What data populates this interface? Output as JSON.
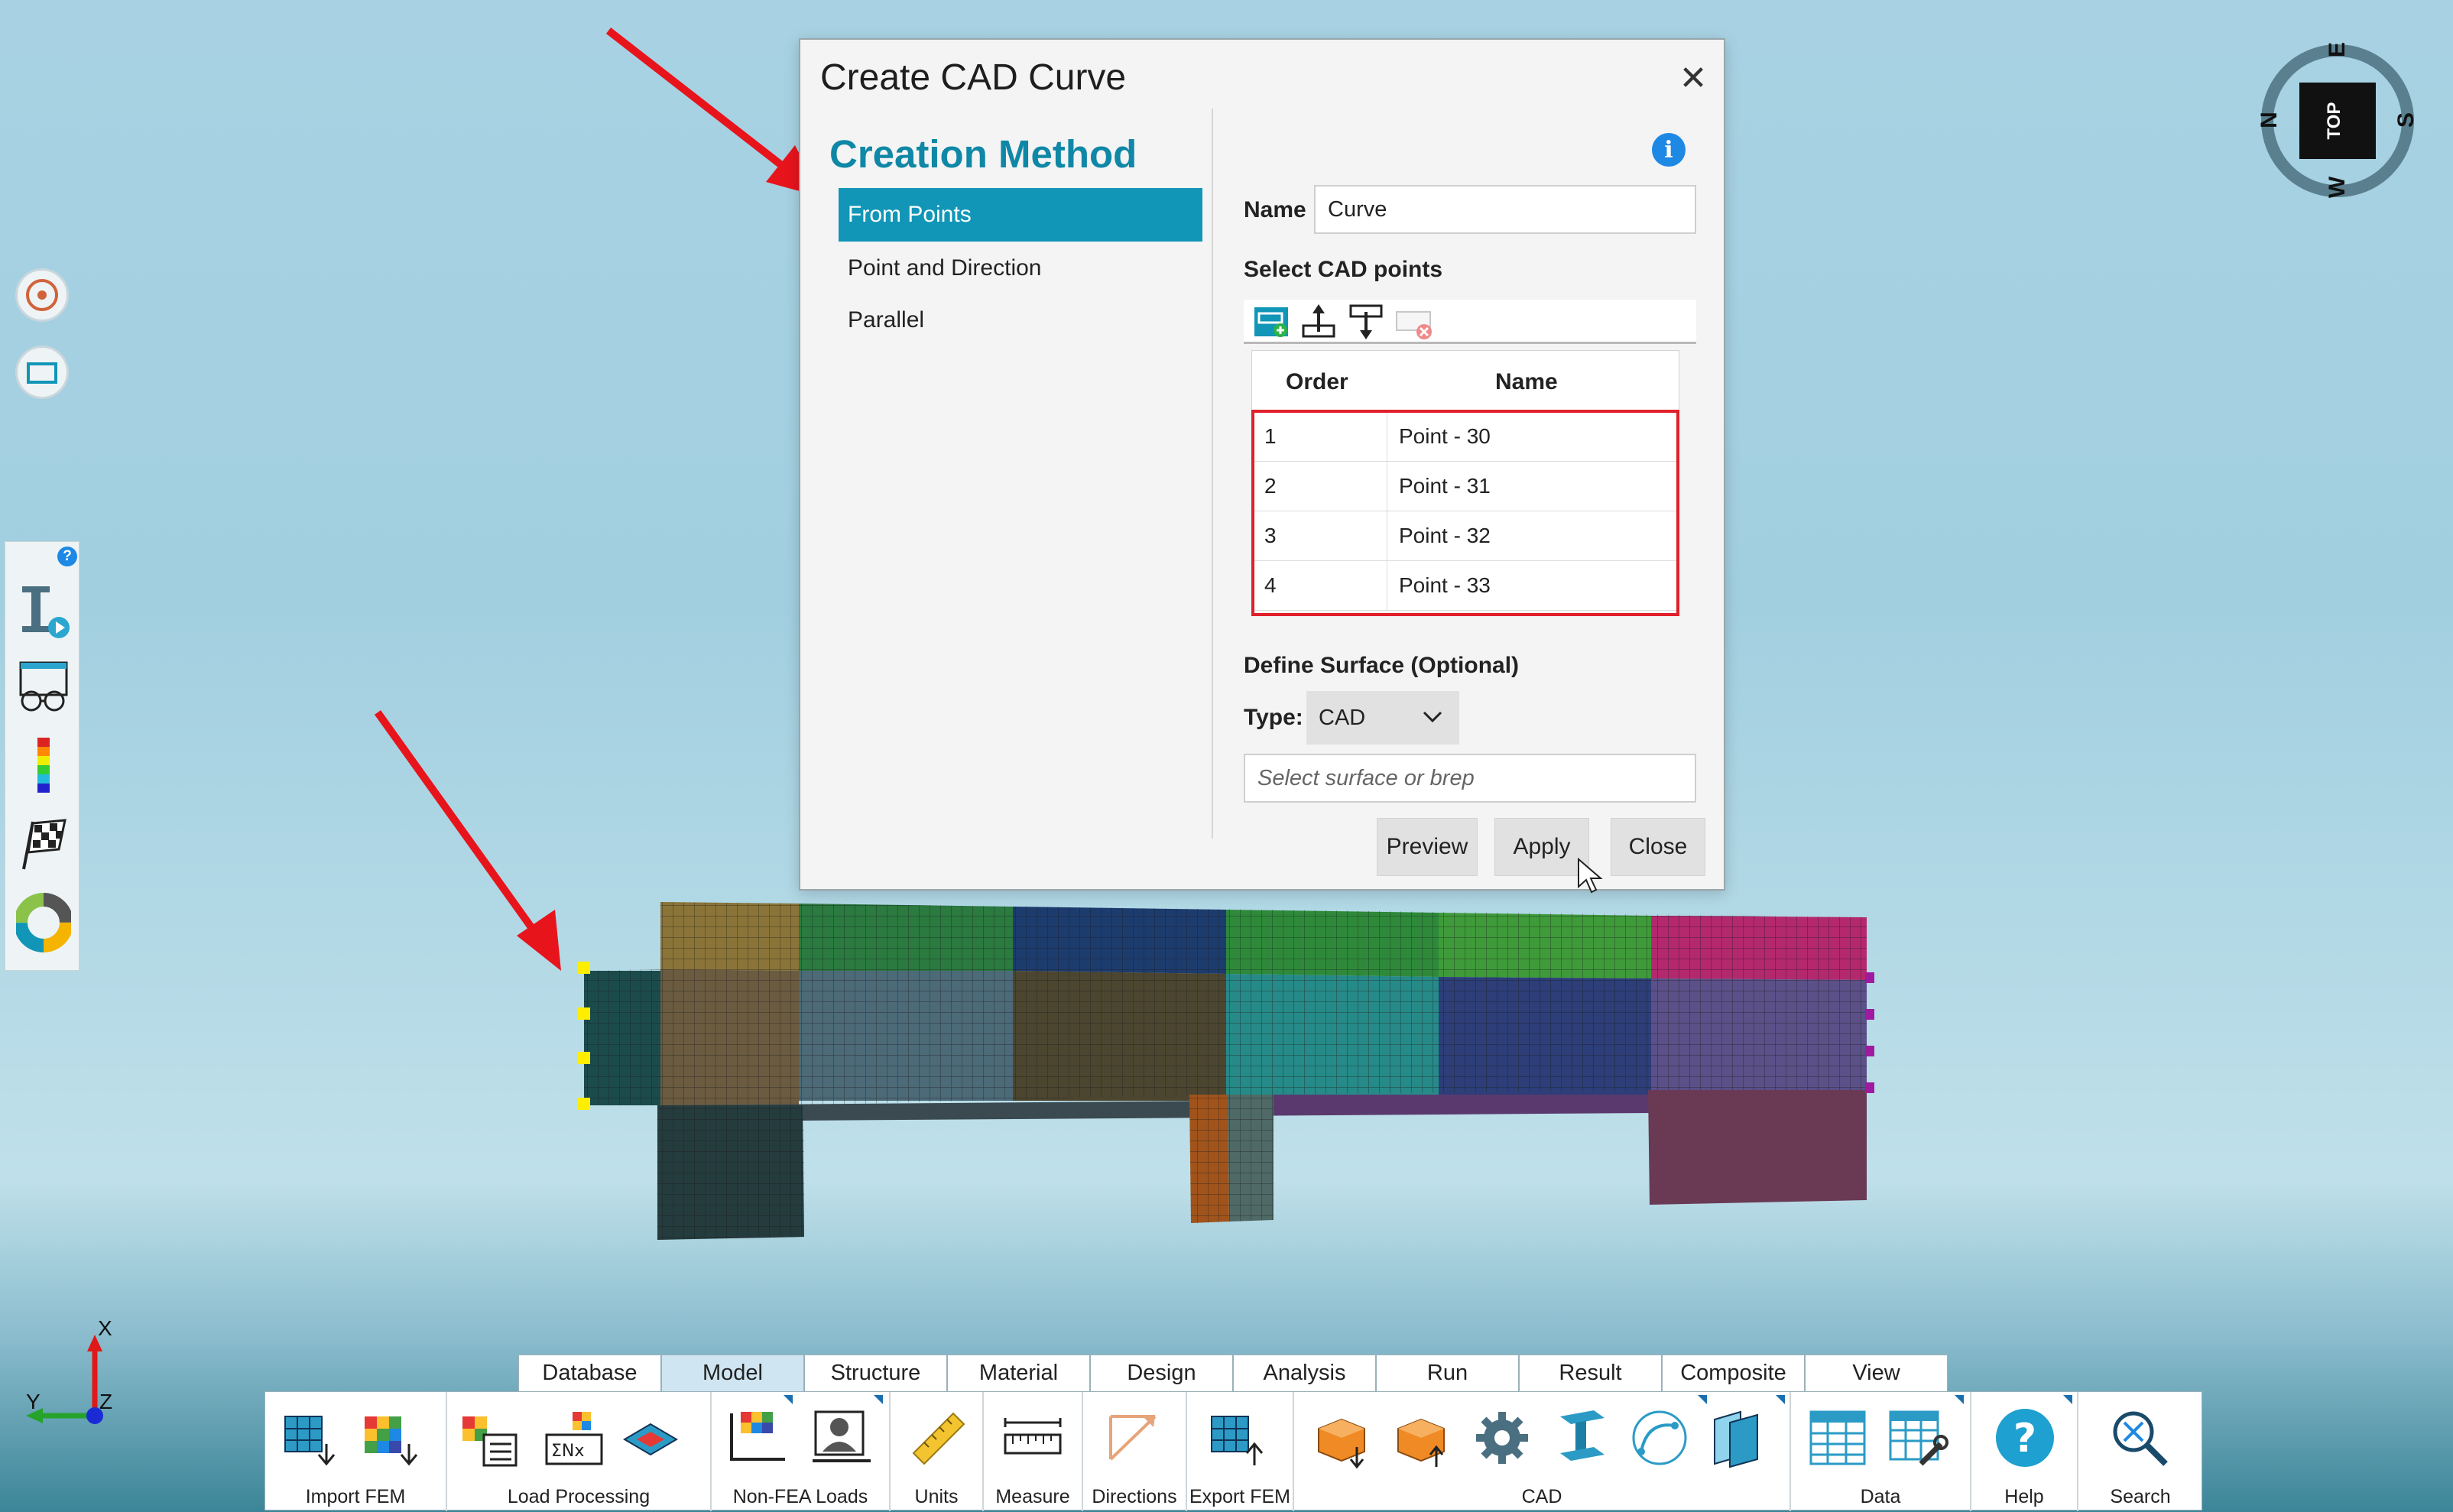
{
  "dialog": {
    "title": "Create CAD Curve",
    "close_glyph": "✕",
    "section_title": "Creation Method",
    "methods": [
      {
        "label": "From Points",
        "selected": true
      },
      {
        "label": "Point and Direction",
        "selected": false
      },
      {
        "label": "Parallel",
        "selected": false
      }
    ],
    "info_glyph": "i",
    "name_label": "Name",
    "name_value": "Curve",
    "select_points_label": "Select CAD points",
    "mini_toolbar_icons": [
      "add-point-icon",
      "move-up-icon",
      "move-down-icon",
      "remove-point-icon"
    ],
    "grid": {
      "columns": [
        "Order",
        "Name"
      ],
      "rows": [
        {
          "order": "1",
          "name": "Point - 30"
        },
        {
          "order": "2",
          "name": "Point - 31"
        },
        {
          "order": "3",
          "name": "Point - 32"
        },
        {
          "order": "4",
          "name": "Point - 33"
        }
      ]
    },
    "surface_section_label": "Define Surface (Optional)",
    "type_label": "Type:",
    "type_value": "CAD",
    "surface_placeholder": "Select surface or brep",
    "buttons": {
      "preview": "Preview",
      "apply": "Apply",
      "close": "Close"
    }
  },
  "compass": {
    "top": "TOP",
    "n": "N",
    "e": "E",
    "s": "S",
    "w": "W"
  },
  "triad": {
    "x": "X",
    "y": "Y",
    "z": "Z"
  },
  "ribbon": {
    "tabs": [
      {
        "label": "Database",
        "active": false
      },
      {
        "label": "Model",
        "active": true
      },
      {
        "label": "Structure",
        "active": false
      },
      {
        "label": "Material",
        "active": false
      },
      {
        "label": "Design",
        "active": false
      },
      {
        "label": "Analysis",
        "active": false
      },
      {
        "label": "Run",
        "active": false
      },
      {
        "label": "Result",
        "active": false
      },
      {
        "label": "Composite",
        "active": false
      },
      {
        "label": "View",
        "active": false
      }
    ],
    "groups": {
      "import_fem": "Import FEM",
      "load_processing": "Load Processing",
      "non_fea_loads": "Non-FEA Loads",
      "units": "Units",
      "measure": "Measure",
      "directions": "Directions",
      "export_fem": "Export FEM",
      "cad": "CAD",
      "data": "Data",
      "help": "Help",
      "search": "Search"
    }
  },
  "colors": {
    "accent": "#1196b7",
    "highlight_box": "#e0202a",
    "annotation_arrow": "#e8141c"
  }
}
